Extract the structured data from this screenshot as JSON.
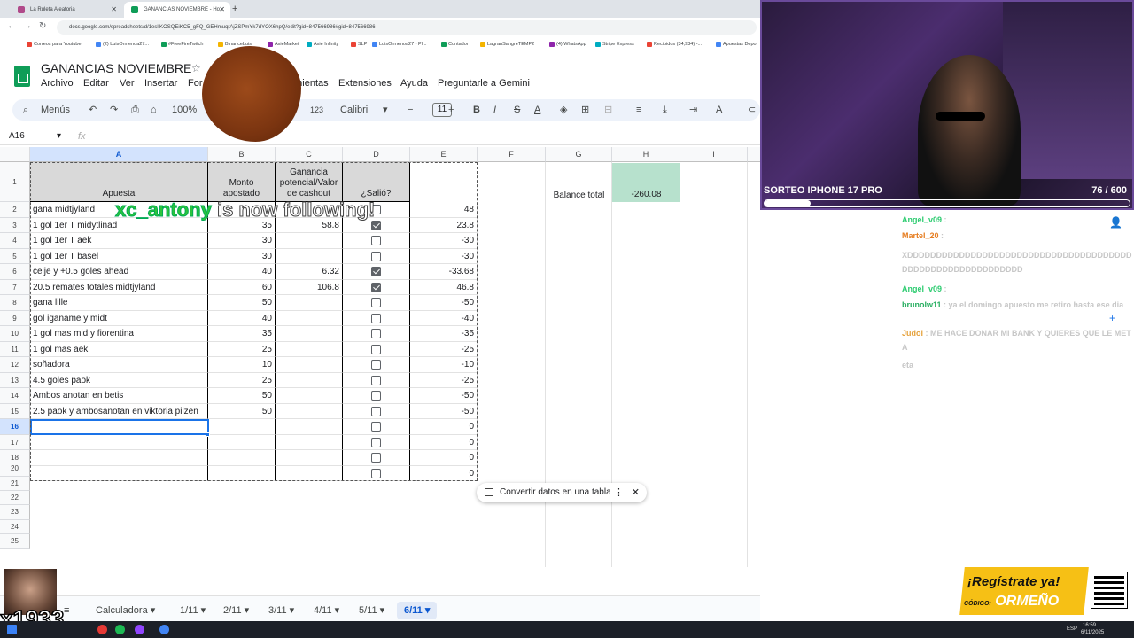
{
  "browser": {
    "tabs": [
      {
        "title": "La Ruleta Aleatoria",
        "color": "#b04a8a"
      },
      {
        "title": "GANANCIAS NOVIEMBRE - Ho...",
        "color": "#0f9d58"
      }
    ],
    "url": "docs.google.com/spreadsheets/d/1esliKOSQEiKC5_gFQ_GEHmuqrAjZSPmYk7dYOX6hpQ/edit?gid=847566986#gid=847566986",
    "bookmarks": [
      "Correos para Youtube",
      "(2) LuisOrmenoa27...",
      "#FreeFireTwitch",
      "BinanceLuis",
      "AxieMarket",
      "Axie Infinity",
      "SLP",
      "LuisOrmenoa27 - Pl...",
      "Contador",
      "LagranSangreTEMP2",
      "(4) WhatsApp",
      "Stripe Express",
      "Recibidos (34,934) -...",
      "Apuestas Depo"
    ]
  },
  "sheets": {
    "title": "GANANCIAS NOVIEMBRE",
    "menu": [
      "Archivo",
      "Editar",
      "Ver",
      "Insertar",
      "For",
      "amientas",
      "Extensiones",
      "Ayuda",
      "Preguntarle a Gemini"
    ],
    "toolbar": {
      "menus": "Menús",
      "zoom": "100%",
      "num_format": "123",
      "font": "Calibri",
      "font_size": "11"
    },
    "name_box": "A16",
    "fx": "fx",
    "columns": [
      "A",
      "B",
      "C",
      "D",
      "E",
      "F",
      "G",
      "H",
      "I"
    ],
    "headers": {
      "apuesta": "Apuesta",
      "monto": "Monto apostado",
      "ganancia": "Ganancia potencial/Valor de cashout",
      "salio": "¿Salió?"
    },
    "balance_label": "Balance total",
    "balance_value": "-260.08",
    "rows": [
      {
        "n": "2",
        "a": "gana midtjyland",
        "b": "",
        "c": "",
        "d": false,
        "e": "48"
      },
      {
        "n": "3",
        "a": "1 gol 1er T midytlinad",
        "b": "35",
        "c": "58.8",
        "d": true,
        "e": "23.8"
      },
      {
        "n": "4",
        "a": "1 gol 1er T aek",
        "b": "30",
        "c": "",
        "d": false,
        "e": "-30"
      },
      {
        "n": "5",
        "a": "1 gol 1er T basel",
        "b": "30",
        "c": "",
        "d": false,
        "e": "-30"
      },
      {
        "n": "6",
        "a": "celje y +0.5 goles ahead",
        "b": "40",
        "c": "6.32",
        "d": true,
        "e": "-33.68"
      },
      {
        "n": "7",
        "a": "20.5 remates totales midtjyland",
        "b": "60",
        "c": "106.8",
        "d": true,
        "e": "46.8"
      },
      {
        "n": "8",
        "a": "gana lille",
        "b": "50",
        "c": "",
        "d": false,
        "e": "-50"
      },
      {
        "n": "9",
        "a": "gol iganame y midt",
        "b": "40",
        "c": "",
        "d": false,
        "e": "-40"
      },
      {
        "n": "10",
        "a": "1 gol mas mid y fiorentina",
        "b": "35",
        "c": "",
        "d": false,
        "e": "-35"
      },
      {
        "n": "11",
        "a": "1 gol mas aek",
        "b": "25",
        "c": "",
        "d": false,
        "e": "-25"
      },
      {
        "n": "12",
        "a": "soñadora",
        "b": "10",
        "c": "",
        "d": false,
        "e": "-10"
      },
      {
        "n": "13",
        "a": "4.5 goles paok",
        "b": "25",
        "c": "",
        "d": false,
        "e": "-25"
      },
      {
        "n": "14",
        "a": "Ambos anotan en betis",
        "b": "50",
        "c": "",
        "d": false,
        "e": "-50"
      },
      {
        "n": "15",
        "a": "2.5 paok y ambosanotan en viktoria pilzen",
        "b": "50",
        "c": "",
        "d": false,
        "e": "-50"
      },
      {
        "n": "16",
        "a": "",
        "b": "",
        "c": "",
        "d": false,
        "e": "0"
      },
      {
        "n": "17",
        "a": "",
        "b": "",
        "c": "",
        "d": false,
        "e": "0"
      },
      {
        "n": "18",
        "a": "",
        "b": "",
        "c": "",
        "d": false,
        "e": "0"
      },
      {
        "n": "19",
        "a": "",
        "b": "",
        "c": "",
        "d": false,
        "e": "0"
      }
    ],
    "empty_rows": [
      "20",
      "21",
      "22",
      "23",
      "24",
      "25"
    ],
    "convert_pill": "Convertir datos en una tabla",
    "sheet_tabs": [
      "Calculadora",
      "1/11",
      "2/11",
      "3/11",
      "4/11",
      "5/11",
      "6/11"
    ],
    "active_tab": "6/11"
  },
  "stream": {
    "follow_user": "xc_antony",
    "follow_text": "is now following!",
    "giveaway_label": "SORTEO IPHONE 17 PRO",
    "giveaway_count": "76 / 600",
    "giveaway_progress": 0.127,
    "chat": [
      {
        "user": "Angel_v09",
        "text": ":"
      },
      {
        "user": "Martel_20",
        "text": ":"
      },
      {
        "user": "",
        "text": "XDDDDDDDDDDDDDDDDDDDDDDDDDDDDDDDDDDDDDDDDDDDDDDDDDDDDDDDDDDDD"
      },
      {
        "user": "Angel_v09",
        "text": ":"
      },
      {
        "user": "brunolw11",
        "text": ": ya el domingo apuesto me retiro hasta ese dia"
      },
      {
        "user": "Judol",
        "text": ": ME HACE DONAR MI BANK Y QUIERES QUE LE META"
      },
      {
        "user": "",
        "text": "eta"
      }
    ],
    "promo_line1": "¡Regístrate ya!",
    "promo_code_label": "CÓDIGO:",
    "promo_code": "ORMEÑO",
    "emote_text": "x1933"
  },
  "taskbar": {
    "lang": "ESP",
    "time": "16:59",
    "date": "6/11/2025"
  }
}
